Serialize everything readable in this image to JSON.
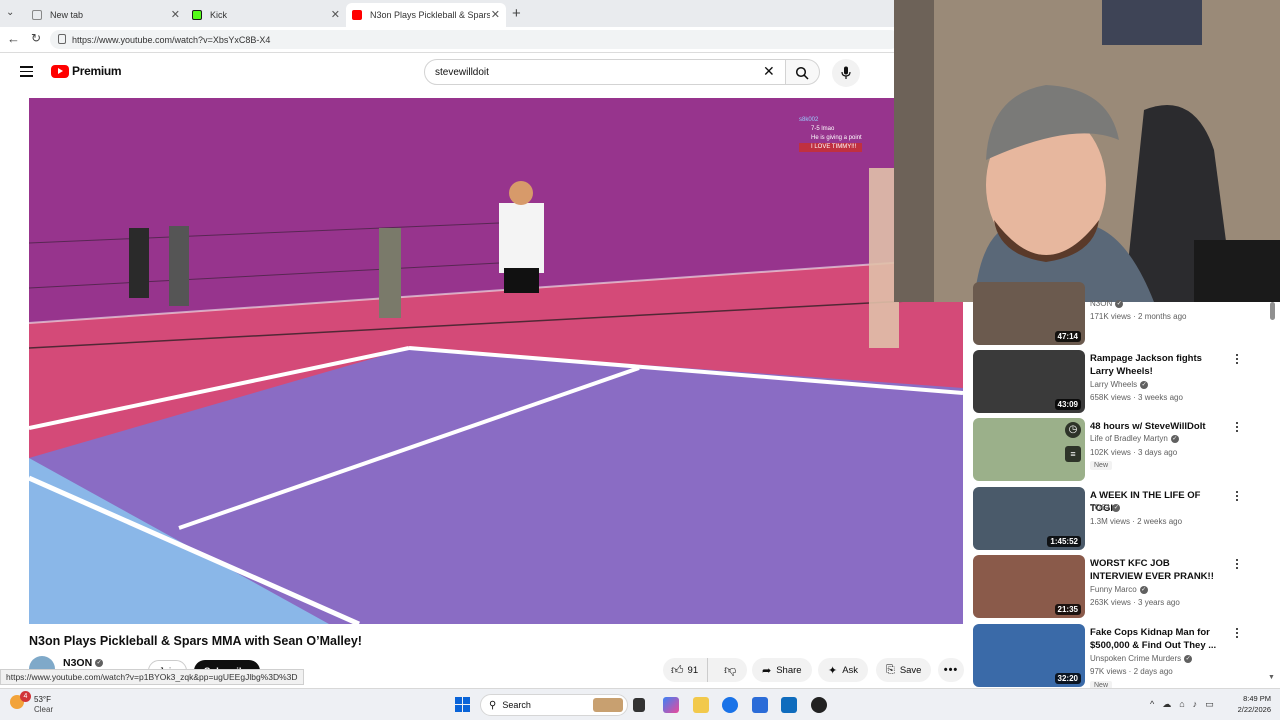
{
  "browser": {
    "tabs": [
      {
        "label": "New tab",
        "active": false
      },
      {
        "label": "Kick",
        "active": false
      },
      {
        "label": "N3on Plays Pickleball & Spars",
        "active": true
      }
    ],
    "url": "https://www.youtube.com/watch?v=XbsYxC8B-X4"
  },
  "youtube": {
    "logo_text": "Premium",
    "search_value": "stevewilldoit"
  },
  "video": {
    "title": "N3on Plays Pickleball & Spars MMA with Sean O’Malley!",
    "channel": "N3ON",
    "join_label": "Join",
    "subscribe_label": "Subscribe",
    "like_count": "91",
    "share_label": "Share",
    "ask_label": "Ask",
    "save_label": "Save",
    "chat_lines": [
      "s8k002",
      "7-5 lmao",
      "He is giving a point",
      "I LOVE TIMMY!!!"
    ]
  },
  "sidebar": {
    "items": [
      {
        "title": "",
        "channel": "N3ON",
        "meta": "171K views · 2 months ago",
        "duration": "47:14",
        "color": "#6b5a4e",
        "verified": true,
        "new": false
      },
      {
        "title": "Rampage Jackson fights Larry Wheels!",
        "channel": "Larry Wheels",
        "meta": "658K views · 3 weeks ago",
        "duration": "43:09",
        "color": "#3a3a3a",
        "verified": true,
        "new": false
      },
      {
        "title": "48 hours w/ SteveWillDoIt",
        "channel": "Life of Bradley Martyn",
        "meta": "102K views · 3 days ago",
        "duration": "",
        "color": "#9bb08a",
        "verified": true,
        "new": true
      },
      {
        "title": "A WEEK IN THE LIFE OF TOGI",
        "channel": "TOGI",
        "meta": "1.3M views · 2 weeks ago",
        "duration": "1:45:52",
        "color": "#4a5a6a",
        "verified": true,
        "new": false
      },
      {
        "title": "WORST KFC JOB INTERVIEW EVER PRANK!!",
        "channel": "Funny Marco",
        "meta": "263K views · 3 years ago",
        "duration": "21:35",
        "color": "#8a5a4a",
        "verified": true,
        "new": false
      },
      {
        "title": "Fake Cops Kidnap Man for $500,000 & Find Out They ...",
        "channel": "Unspoken Crime Murders",
        "meta": "97K views · 2 days ago",
        "duration": "32:20",
        "color": "#3a6aa8",
        "verified": true,
        "new": true
      }
    ],
    "new_label": "New"
  },
  "status_url": "https://www.youtube.com/watch?v=p1BYOk3_zqk&pp=ugUEEgJlbg%3D%3D",
  "taskbar": {
    "weather_temp": "53°F",
    "weather_desc": "Clear",
    "notif_count": "4",
    "search_label": "Search",
    "time": "8:49 PM",
    "date": "2/22/2026"
  }
}
